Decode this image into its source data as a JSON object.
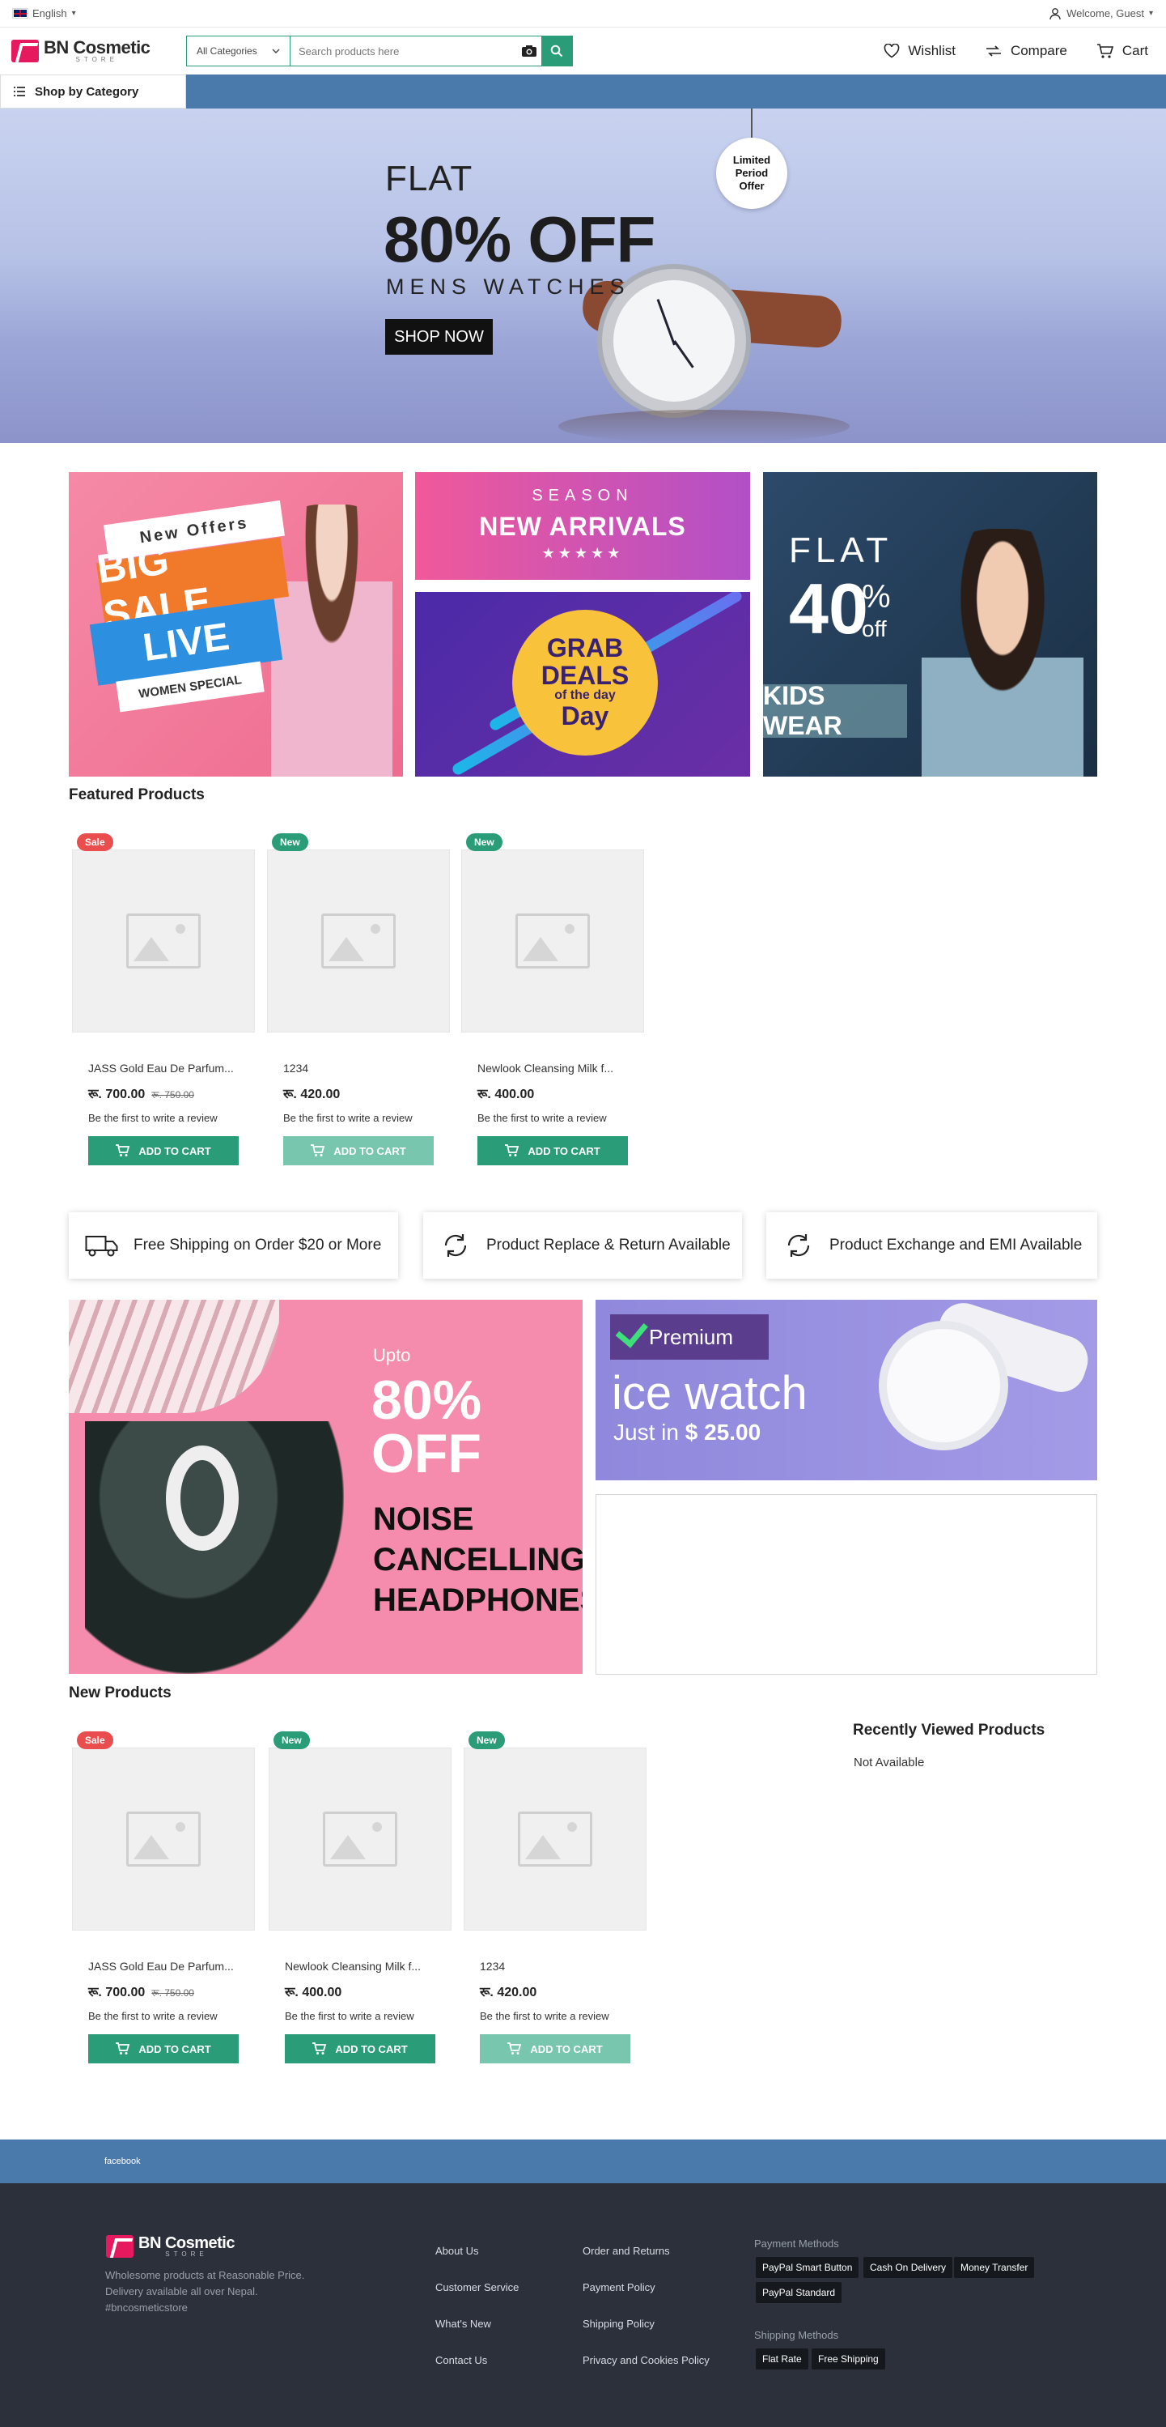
{
  "topbar": {
    "language": "English",
    "welcome": "Welcome, Guest"
  },
  "header": {
    "logo_name": "BN Cosmetic",
    "logo_sub": "STORE",
    "category_select": "All Categories",
    "search_placeholder": "Search products here",
    "wishlist": "Wishlist",
    "compare": "Compare",
    "cart": "Cart"
  },
  "nav": {
    "shop_by_category": "Shop by Category"
  },
  "hero": {
    "flat": "FLAT",
    "percent": "80% OFF",
    "subtitle": "MENS WATCHES",
    "button": "SHOP NOW",
    "tag_lines": [
      "Limited",
      "Period",
      "Offer"
    ]
  },
  "promos": {
    "bigsale": {
      "offer": "New Offers",
      "big": "BIG SALE",
      "live": "LIVE",
      "women": "WOMEN SPECIAL"
    },
    "season": {
      "line1": "SEASON",
      "line2": "NEW ARRIVALS",
      "stars": "★★★★★"
    },
    "grab": {
      "line1": "GRAB",
      "line2": "DEALS",
      "line3": "of the day",
      "line4": "Day"
    },
    "kids": {
      "flat": "FLAT",
      "pct": "40",
      "pct_sign": "%",
      "off": "off",
      "label": "KIDS WEAR"
    }
  },
  "featured": {
    "title": "Featured Products",
    "products": [
      {
        "badge": "Sale",
        "badge_type": "sale",
        "name": "JASS Gold Eau De Parfum...",
        "price": "रू. 700.00",
        "old_price": "रू. 750.00",
        "review": "Be the first to write a review",
        "button": "ADD TO CART",
        "button_faded": false
      },
      {
        "badge": "New",
        "badge_type": "new",
        "name": "1234",
        "price": "रू. 420.00",
        "old_price": "",
        "review": "Be the first to write a review",
        "button": "ADD TO CART",
        "button_faded": true
      },
      {
        "badge": "New",
        "badge_type": "new",
        "name": "Newlook Cleansing Milk f...",
        "price": "रू. 400.00",
        "old_price": "",
        "review": "Be the first to write a review",
        "button": "ADD TO CART",
        "button_faded": false
      }
    ]
  },
  "features": [
    {
      "icon": "truck-icon",
      "label": "Free Shipping on Order $20 or More"
    },
    {
      "icon": "refresh-icon",
      "label": "Product Replace & Return Available"
    },
    {
      "icon": "refresh-icon",
      "label": "Product Exchange and EMI Available"
    }
  ],
  "headphones_banner": {
    "upto": "Upto",
    "pct": "80%",
    "off": "OFF",
    "lines": [
      "NOISE",
      "CANCELLING",
      "HEADPHONES"
    ]
  },
  "ice_banner": {
    "premium": "Premium",
    "title": "ice watch",
    "just": "Just in",
    "price": "$ 25.00"
  },
  "new_products": {
    "title": "New Products",
    "products": [
      {
        "badge": "Sale",
        "badge_type": "sale",
        "name": "JASS Gold Eau De Parfum...",
        "price": "रू. 700.00",
        "old_price": "रू. 750.00",
        "review": "Be the first to write a review",
        "button": "ADD TO CART",
        "button_faded": false
      },
      {
        "badge": "New",
        "badge_type": "new",
        "name": "Newlook Cleansing Milk f...",
        "price": "रू. 400.00",
        "old_price": "",
        "review": "Be the first to write a review",
        "button": "ADD TO CART",
        "button_faded": false
      },
      {
        "badge": "New",
        "badge_type": "new",
        "name": "1234",
        "price": "रू. 420.00",
        "old_price": "",
        "review": "Be the first to write a review",
        "button": "ADD TO CART",
        "button_faded": true
      }
    ]
  },
  "recently_viewed": {
    "title": "Recently Viewed Products",
    "empty": "Not Available"
  },
  "footer": {
    "social": "facebook",
    "logo_name": "BN Cosmetic",
    "logo_sub": "STORE",
    "description": "Wholesome products at Reasonable Price. Delivery available all over Nepal. #bncosmeticstore",
    "links_col1": [
      "About Us",
      "Customer Service",
      "What's New",
      "Contact Us"
    ],
    "links_col2": [
      "Order and Returns",
      "Payment Policy",
      "Shipping Policy",
      "Privacy and Cookies Policy"
    ],
    "payment_title": "Payment Methods",
    "payment_methods": [
      "PayPal Smart Button",
      "Cash On Delivery",
      "Money Transfer",
      "PayPal Standard"
    ],
    "shipping_title": "Shipping Methods",
    "shipping_methods": [
      "Flat Rate",
      "Free Shipping"
    ]
  },
  "colors": {
    "accent": "#2a9d78",
    "nav": "#4a7aab",
    "footer": "#2b303b",
    "sale": "#e94d4d"
  }
}
